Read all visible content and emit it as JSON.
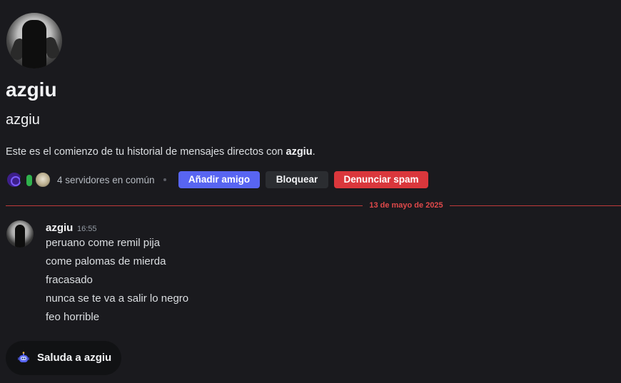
{
  "profile": {
    "display_name": "azgiu",
    "username": "azgiu",
    "intro_prefix": "Este es el comienzo de tu historial de mensajes directos con ",
    "intro_name": "azgiu",
    "intro_suffix": "."
  },
  "mutual": {
    "servers_text": "4 servidores en común",
    "server_icons": [
      "server-icon-purple",
      "server-icon-green",
      "server-icon-photo"
    ]
  },
  "actions": {
    "add_friend": "Añadir amigo",
    "block": "Bloquear",
    "report_spam": "Denunciar spam"
  },
  "divider": {
    "date": "13 de mayo de 2025"
  },
  "message": {
    "author": "azgiu",
    "time": "16:55",
    "lines": [
      "peruano come remil pija",
      "come palomas de mierda",
      "fracasado",
      "nunca se te va a salir lo negro",
      "feo horrible"
    ]
  },
  "wave": {
    "label": "Saluda a azgiu"
  },
  "colors": {
    "background": "#1a1a1e",
    "blurple": "#5865f2",
    "danger": "#da373c",
    "divider_red": "#e0494a"
  }
}
